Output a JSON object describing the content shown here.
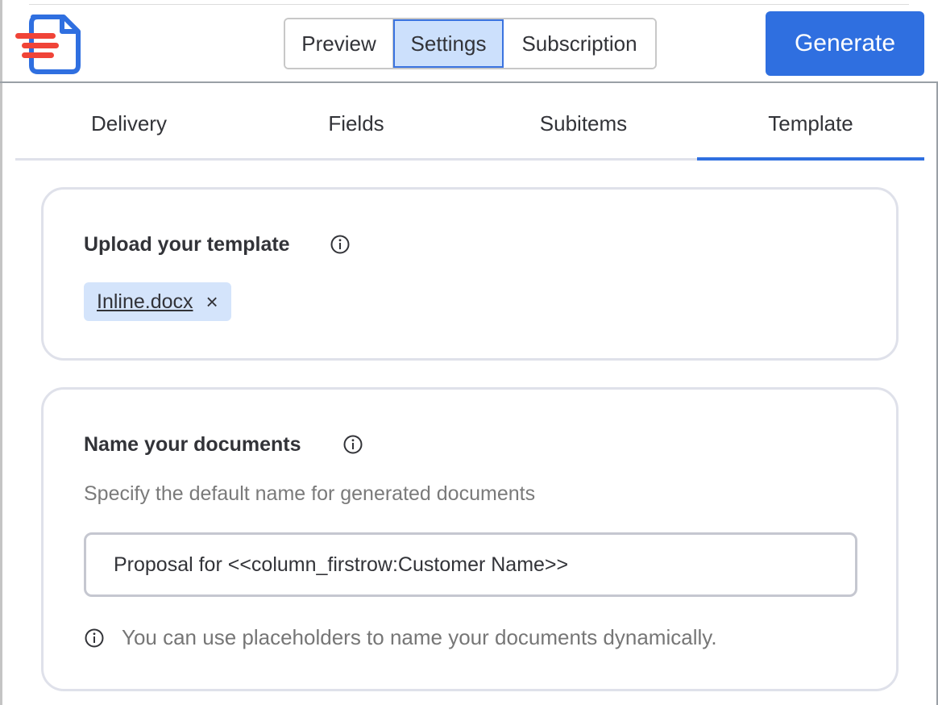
{
  "header": {
    "logo_icon": "document-lines-logo-icon",
    "segments": [
      {
        "label": "Preview"
      },
      {
        "label": "Settings"
      },
      {
        "label": "Subscription"
      }
    ],
    "active_segment": "Settings",
    "generate_label": "Generate"
  },
  "tabs": [
    {
      "label": "Delivery"
    },
    {
      "label": "Fields"
    },
    {
      "label": "Subitems"
    },
    {
      "label": "Template"
    }
  ],
  "active_tab": "Template",
  "upload_card": {
    "title": "Upload your template",
    "info_icon": "info-icon",
    "file_chip": {
      "label": "Inline.docx",
      "remove": "×"
    }
  },
  "name_card": {
    "title": "Name your documents",
    "info_icon": "info-icon",
    "subtitle": "Specify the default name for generated documents",
    "input_value": "Proposal for <<column_firstrow:Customer Name>>",
    "hint": "You can use placeholders to name your documents dynamically."
  },
  "colors": {
    "primary": "#2f6fe0",
    "selected_segment_bg": "#cce0fc",
    "chip_bg": "#d4e4fb",
    "logo_red": "#f04438",
    "card_border": "#dfe1ea"
  }
}
